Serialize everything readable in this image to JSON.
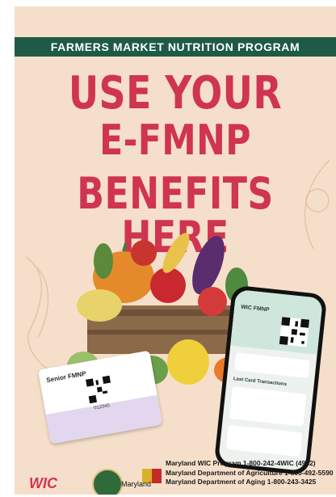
{
  "banner": "FARMERS MARKET NUTRITION PROGRAM",
  "headline": {
    "line1": "USE YOUR",
    "line2": "E-FMNP",
    "line3": "BENEFITS HERE"
  },
  "card": {
    "title": "Senior FMNP",
    "number": "012345"
  },
  "phone": {
    "title": "WIC FMNP",
    "section": "Last Card Transactions"
  },
  "contacts": [
    "Maryland WIC Program 1-800-242-4WIC (4942)",
    "Maryland Department of Agriculture 1-800-492-5590",
    "Maryland Department of Aging 1-800-243-3425"
  ],
  "logos": {
    "wic": "WIC",
    "maryland": "Maryland"
  },
  "colors": {
    "banner": "#1f5a47",
    "headline": "#cf3550",
    "background": "#f6dfca"
  }
}
